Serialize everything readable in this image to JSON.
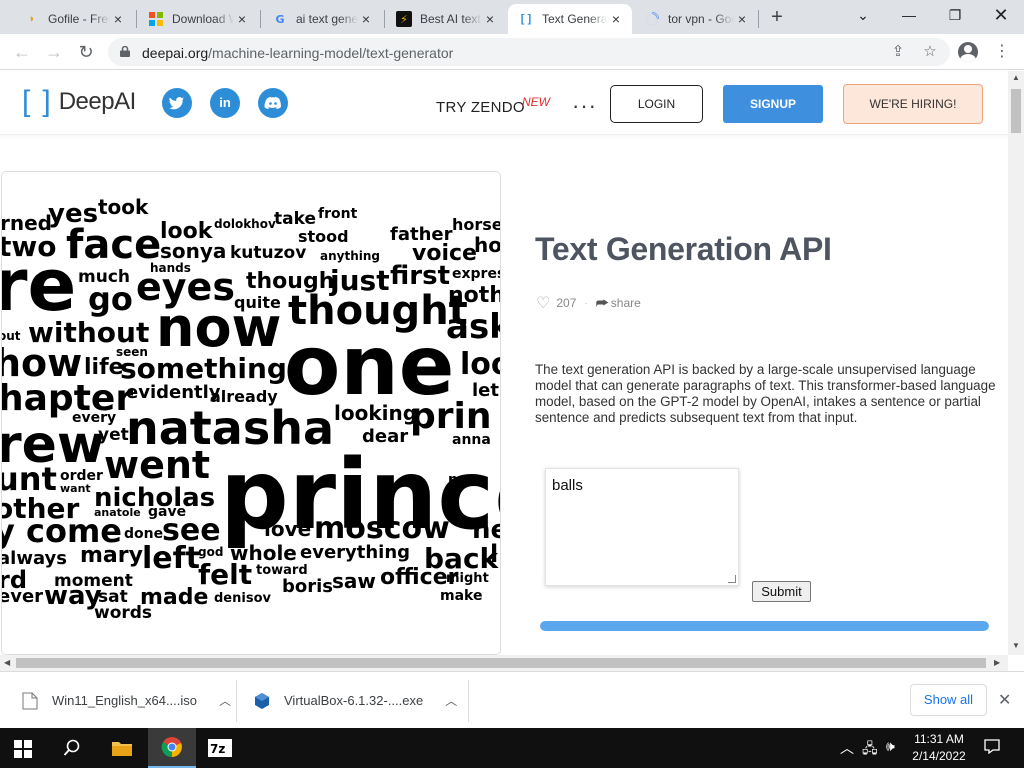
{
  "browser": {
    "tabs": [
      {
        "title": "Gofile - Free",
        "active": false
      },
      {
        "title": "Download Wi",
        "active": false
      },
      {
        "title": "ai text genera",
        "active": false
      },
      {
        "title": "Best AI text",
        "active": false
      },
      {
        "title": "Text Generat",
        "active": true
      },
      {
        "title": "tor vpn - Goo",
        "active": false
      }
    ],
    "url_domain": "deepai.org",
    "url_path": "/machine-learning-model/text-generator"
  },
  "site": {
    "logo_text": "DeepAI",
    "logo_left_bracket": "[",
    "logo_right_bracket": "]",
    "social": [
      "twitter-icon",
      "linkedin-icon",
      "discord-icon"
    ],
    "nav": {
      "zendo": "TRY ZENDO",
      "zendo_badge": "NEW",
      "more": "···",
      "login": "LOGIN",
      "signup": "SIGNUP",
      "hiring": "WE'RE HIRING!"
    }
  },
  "main": {
    "title": "Text Generation API",
    "likes": "207",
    "share": "share",
    "description": "The text generation API is backed by a large-scale unsupervised language model that can generate paragraphs of text. This transformer-based language model, based on the GPT-2 model by OpenAI, intakes a sentence or partial sentence and predicts subsequent text from that input.",
    "input_value": "balls",
    "submit_label": "Submit",
    "progress": 1.0
  },
  "wordcloud": {
    "words": [
      {
        "t": "rned"
      },
      {
        "t": "yes"
      },
      {
        "t": "took"
      },
      {
        "t": "front"
      },
      {
        "t": "horse"
      },
      {
        "t": "two"
      },
      {
        "t": "face"
      },
      {
        "t": "look"
      },
      {
        "t": "dolokhov"
      },
      {
        "t": "take"
      },
      {
        "t": "stood"
      },
      {
        "t": "father"
      },
      {
        "t": "ho"
      },
      {
        "t": "sonya"
      },
      {
        "t": "kutuzov"
      },
      {
        "t": "anything"
      },
      {
        "t": "voice"
      },
      {
        "t": "re"
      },
      {
        "t": "much"
      },
      {
        "t": "hands"
      },
      {
        "t": "eyes"
      },
      {
        "t": "though"
      },
      {
        "t": "just"
      },
      {
        "t": "first"
      },
      {
        "t": "express"
      },
      {
        "t": "go"
      },
      {
        "t": "quite"
      },
      {
        "t": "thought"
      },
      {
        "t": "nothi"
      },
      {
        "t": "out"
      },
      {
        "t": "without"
      },
      {
        "t": "now"
      },
      {
        "t": "ask"
      },
      {
        "t": "one"
      },
      {
        "t": "seen"
      },
      {
        "t": "how"
      },
      {
        "t": "life"
      },
      {
        "t": "something"
      },
      {
        "t": "loo"
      },
      {
        "t": "hapter"
      },
      {
        "t": "evidently"
      },
      {
        "t": "already"
      },
      {
        "t": "let"
      },
      {
        "t": "every"
      },
      {
        "t": "looking"
      },
      {
        "t": "prin"
      },
      {
        "t": "rew"
      },
      {
        "t": "yet"
      },
      {
        "t": "natasha"
      },
      {
        "t": "dear"
      },
      {
        "t": "anna"
      },
      {
        "t": "unt"
      },
      {
        "t": "order"
      },
      {
        "t": "want"
      },
      {
        "t": "went"
      },
      {
        "t": "prince"
      },
      {
        "t": "new"
      },
      {
        "t": "other"
      },
      {
        "t": "nicholas"
      },
      {
        "t": "anatole"
      },
      {
        "t": "gave"
      },
      {
        "t": "y come"
      },
      {
        "t": "done"
      },
      {
        "t": "see"
      },
      {
        "t": "love"
      },
      {
        "t": "moscow"
      },
      {
        "t": "he"
      },
      {
        "t": "always"
      },
      {
        "t": "mary"
      },
      {
        "t": "left"
      },
      {
        "t": "god"
      },
      {
        "t": "whole"
      },
      {
        "t": "everything"
      },
      {
        "t": "back"
      },
      {
        "t": "li"
      },
      {
        "t": "rd"
      },
      {
        "t": "moment"
      },
      {
        "t": "felt"
      },
      {
        "t": "toward"
      },
      {
        "t": "saw"
      },
      {
        "t": "officer"
      },
      {
        "t": "might"
      },
      {
        "t": "ever"
      },
      {
        "t": "way"
      },
      {
        "t": "sat"
      },
      {
        "t": "made"
      },
      {
        "t": "boris"
      },
      {
        "t": "denisov"
      },
      {
        "t": "make"
      },
      {
        "t": "words"
      }
    ]
  },
  "downloads": {
    "items": [
      {
        "name": "Win11_English_x64....iso"
      },
      {
        "name": "VirtualBox-6.1.32-....exe"
      }
    ],
    "show_all": "Show all"
  },
  "taskbar": {
    "time": "11:31 AM",
    "date": "2/14/2022",
    "apps": [
      "windows-start-icon",
      "search-icon",
      "file-explorer-icon",
      "chrome-icon",
      "7zip-icon"
    ]
  },
  "colors": {
    "brand": "#2d8dd6",
    "signup": "#3f8fdf",
    "hiring_bg": "#fde7da",
    "progress": "#5aa7ee",
    "new_badge": "#d9302e"
  }
}
